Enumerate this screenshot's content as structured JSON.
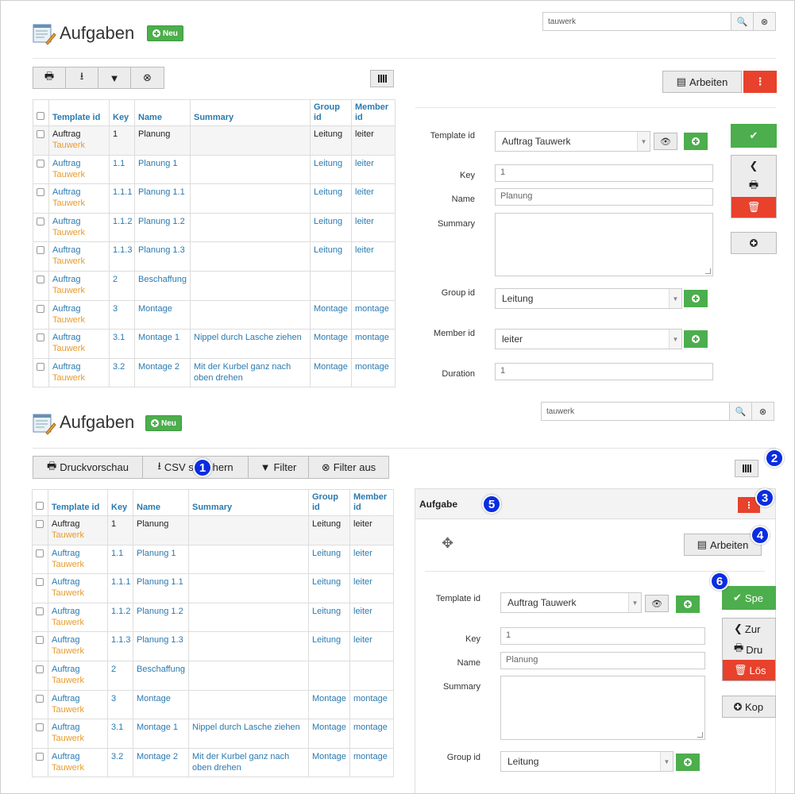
{
  "page": {
    "title": "Aufgaben",
    "new_label": "Neu",
    "search_value": "tauwerk"
  },
  "toolbar_top": {
    "items": [
      "print-icon",
      "download-icon",
      "filter-icon",
      "filter-off-icon"
    ]
  },
  "toolbar_bottom": {
    "print_label": "Druckvorschau",
    "csv_label": "CSV speichern",
    "filter_label": "Filter",
    "filter_off_label": "Filter aus"
  },
  "table": {
    "columns": [
      "Template id",
      "Key",
      "Name",
      "Summary",
      "Group id",
      "Member id"
    ],
    "col_group": [
      "Group",
      "id"
    ],
    "col_member": [
      "Member",
      "id"
    ],
    "rows": [
      {
        "tpl1": "Auftrag",
        "tpl2": "Tauwerk",
        "key": "1",
        "name": "Planung",
        "summary": "",
        "group": "Leitung",
        "member": "leiter"
      },
      {
        "tpl1": "Auftrag",
        "tpl2": "Tauwerk",
        "key": "1.1",
        "name": "Planung 1",
        "summary": "",
        "group": "Leitung",
        "member": "leiter"
      },
      {
        "tpl1": "Auftrag",
        "tpl2": "Tauwerk",
        "key": "1.1.1",
        "name": "Planung 1.1",
        "summary": "",
        "group": "Leitung",
        "member": "leiter"
      },
      {
        "tpl1": "Auftrag",
        "tpl2": "Tauwerk",
        "key": "1.1.2",
        "name": "Planung 1.2",
        "summary": "",
        "group": "Leitung",
        "member": "leiter"
      },
      {
        "tpl1": "Auftrag",
        "tpl2": "Tauwerk",
        "key": "1.1.3",
        "name": "Planung 1.3",
        "summary": "",
        "group": "Leitung",
        "member": "leiter"
      },
      {
        "tpl1": "Auftrag",
        "tpl2": "Tauwerk",
        "key": "2",
        "name": "Beschaffung",
        "summary": "",
        "group": "",
        "member": ""
      },
      {
        "tpl1": "Auftrag",
        "tpl2": "Tauwerk",
        "key": "3",
        "name": "Montage",
        "summary": "",
        "group": "Montage",
        "member": "montage"
      },
      {
        "tpl1": "Auftrag",
        "tpl2": "Tauwerk",
        "key": "3.1",
        "name": "Montage 1",
        "summary": "Nippel durch Lasche ziehen",
        "group": "Montage",
        "member": "montage"
      },
      {
        "tpl1": "Auftrag",
        "tpl2": "Tauwerk",
        "key": "3.2",
        "name": "Montage 2",
        "summary": "Mit der Kurbel ganz nach oben drehen",
        "group": "Montage",
        "member": "montage"
      }
    ]
  },
  "detail": {
    "card_title": "Aufgabe",
    "arbeiten_label": "Arbeiten",
    "labels": {
      "template": "Template id",
      "key": "Key",
      "name": "Name",
      "summary": "Summary",
      "group": "Group id",
      "member": "Member id",
      "duration": "Duration"
    },
    "values": {
      "template": "Auftrag Tauwerk",
      "key": "1",
      "name": "Planung",
      "group": "Leitung",
      "member": "leiter",
      "duration": "1"
    },
    "side_buttons": {
      "save": "Spe",
      "back": "Zur",
      "print": "Dru",
      "delete": "Lös",
      "copy": "Kop"
    }
  },
  "markers": [
    "1",
    "2",
    "3",
    "4",
    "5",
    "6"
  ],
  "colors": {
    "accent_green": "#4cae4c",
    "accent_red": "#e8412c",
    "link_blue": "#2a7ab0",
    "template_orange": "#e89b2e",
    "marker_blue": "#0a2de0"
  }
}
